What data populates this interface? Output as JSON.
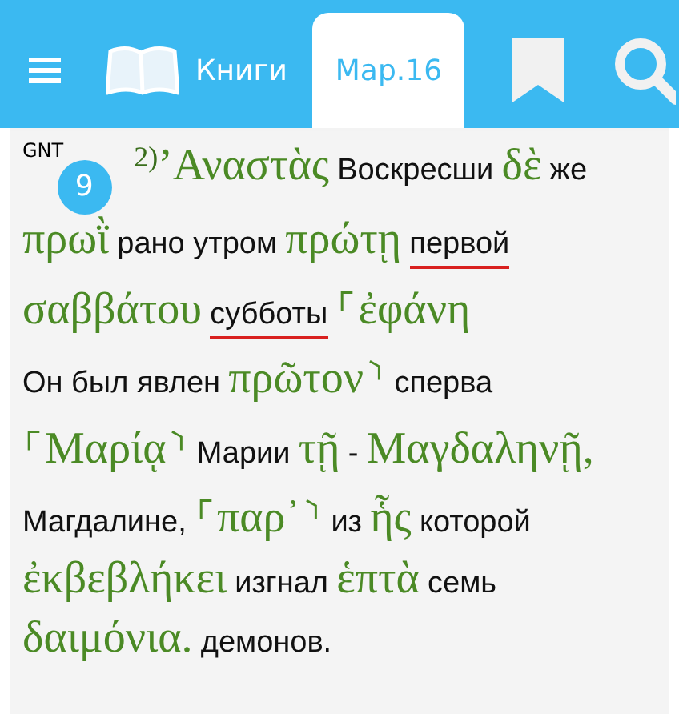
{
  "header": {
    "tabs": [
      {
        "kind": "menu",
        "selected": false
      },
      {
        "kind": "books",
        "label": "Книги",
        "selected": false
      },
      {
        "kind": "text",
        "label": "Мар.16",
        "selected": true
      },
      {
        "kind": "bookmark",
        "selected": false
      },
      {
        "kind": "search",
        "selected": false
      }
    ]
  },
  "verse": {
    "version": "GNT",
    "number": "9",
    "footnote": "2)",
    "words": [
      {
        "kind": "greek",
        "text": "’Αναστὰς"
      },
      {
        "kind": "russian",
        "text": "Воскресши",
        "underlined": false
      },
      {
        "kind": "greek",
        "text": "δὲ"
      },
      {
        "kind": "russian",
        "text": "же",
        "underlined": false
      },
      {
        "kind": "greek",
        "text": "πρωῒ"
      },
      {
        "kind": "russian",
        "text": "рано утром",
        "underlined": false
      },
      {
        "kind": "greek",
        "text": "πρώτῃ"
      },
      {
        "kind": "russian",
        "text": "первой",
        "underlined": true
      },
      {
        "kind": "greek",
        "text": "σαββάτου"
      },
      {
        "kind": "russian",
        "text": "субботы",
        "underlined": true
      },
      {
        "kind": "greek",
        "text": "⸀ἐφάνη"
      },
      {
        "kind": "russian",
        "text": "Он был явлен",
        "underlined": false
      },
      {
        "kind": "greek",
        "text": "πρῶτον⸃"
      },
      {
        "kind": "russian",
        "text": "сперва",
        "underlined": false
      },
      {
        "kind": "greek",
        "text": "⸀Μαρίᾳ⸃"
      },
      {
        "kind": "russian",
        "text": "Марии",
        "underlined": false
      },
      {
        "kind": "greek",
        "text": "τῇ"
      },
      {
        "kind": "russian",
        "text": "-",
        "underlined": false
      },
      {
        "kind": "greek",
        "text": "Μαγδαληνῇ,"
      },
      {
        "kind": "russian",
        "text": "Магдалине,",
        "underlined": false
      },
      {
        "kind": "greek",
        "text": "⸀παρ᾽⸃"
      },
      {
        "kind": "russian",
        "text": "из",
        "underlined": false
      },
      {
        "kind": "greek",
        "text": "ἧς"
      },
      {
        "kind": "russian",
        "text": "которой",
        "underlined": false
      },
      {
        "kind": "greek",
        "text": "ἐκβεβλήκει"
      },
      {
        "kind": "russian",
        "text": "изгнал",
        "underlined": false
      },
      {
        "kind": "greek",
        "text": "ἑπτὰ"
      },
      {
        "kind": "russian",
        "text": "семь",
        "underlined": false
      },
      {
        "kind": "greek",
        "text": "δαιμόνια."
      },
      {
        "kind": "russian",
        "text": "демонов.",
        "underlined": false
      }
    ]
  }
}
